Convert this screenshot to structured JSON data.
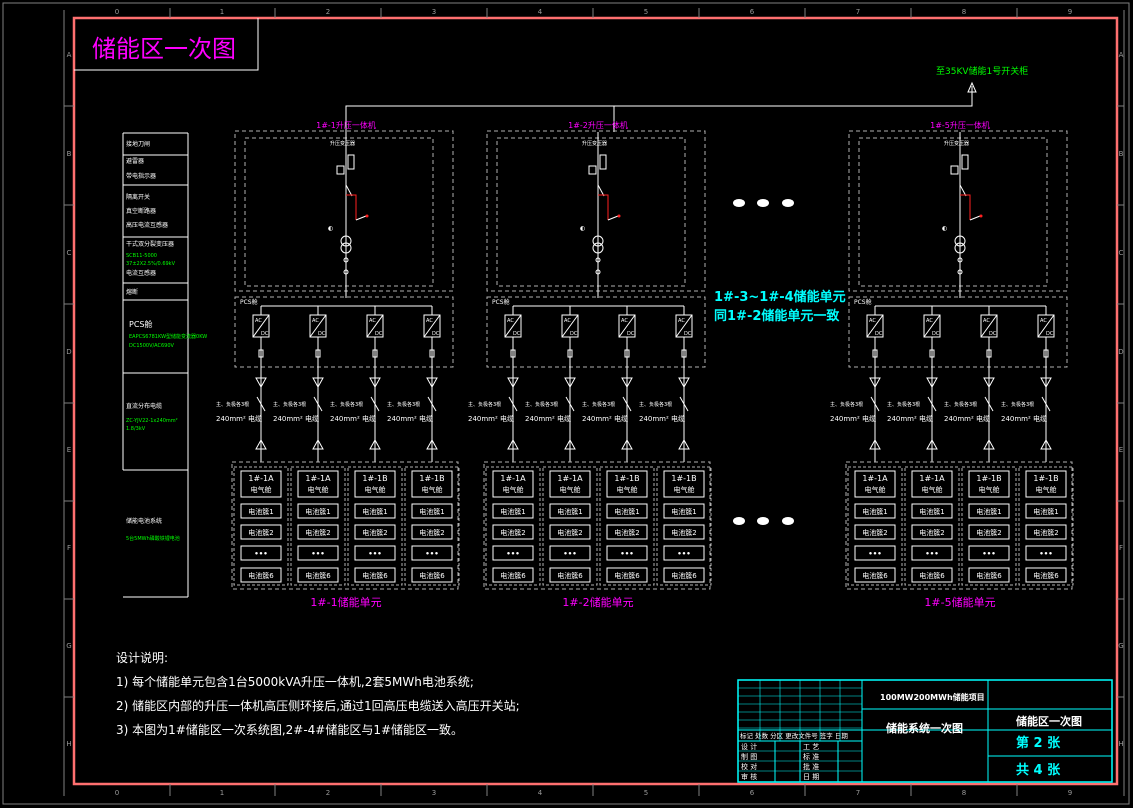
{
  "drawing_title": "储能区一次图",
  "hv_feed_label": "至35KV储能1号开关柜",
  "col_digits": [
    "0",
    "1",
    "2",
    "3",
    "4",
    "5",
    "6",
    "7",
    "8",
    "9"
  ],
  "row_letters": [
    "A",
    "B",
    "C",
    "D",
    "E",
    "F",
    "G",
    "H"
  ],
  "legend": {
    "items": [
      {
        "text": "接地刀闸"
      },
      {
        "text": "避雷器"
      },
      {
        "text": "带电指示器"
      },
      {
        "text": "隔离开关"
      },
      {
        "text": "真空断路器"
      },
      {
        "text": "高压电流互感器"
      },
      {
        "text": "干式双分裂变压器"
      },
      {
        "text": "SCB11-5000"
      },
      {
        "text": "37±2X2.5%/0.69kV"
      },
      {
        "text": "电流互感器"
      },
      {
        "text": "熔断"
      },
      {
        "text": "PCS舱"
      },
      {
        "text": "EAPCS6781KW型储能变流器0KW"
      },
      {
        "text": "DC1500V/AC690V"
      },
      {
        "text": "直流分布电缆"
      },
      {
        "text": "ZC-YJV22-1x240mm²"
      },
      {
        "text": "1.8/3kV"
      },
      {
        "text": "储能电池系统"
      },
      {
        "text": "5台5MWh磷酸铁锂电池"
      }
    ]
  },
  "unit": {
    "transformer_label": "升压变压器",
    "pcs_label": "PCS舱",
    "acdc": [
      "AC",
      "DC"
    ],
    "cable_spec_a": "主、负极各3根",
    "cable_spec_b": "240mm² 电缆",
    "battery_slots": [
      "1#-1A",
      "1#-1A",
      "1#-1B",
      "1#-1B"
    ],
    "battery_sub": "电气舱",
    "cluster_rows": [
      "电池簇1",
      "电池簇2",
      "•••",
      "电池簇6"
    ]
  },
  "units": [
    {
      "title": "1#-1升压一体机",
      "caption": "1#-1储能单元"
    },
    {
      "title": "1#-2升压一体机",
      "caption": "1#-2储能单元"
    },
    {
      "title": "1#-5升压一体机",
      "caption": "1#-5储能单元"
    }
  ],
  "note_same": [
    "1#-3~1#-4储能单元",
    "同1#-2储能单元一致"
  ],
  "design_notes": {
    "heading": "设计说明:",
    "lines": [
      "1) 每个储能单元包含1台5000kVA升压一体机,2套5MWh电池系统;",
      "2) 储能区内部的升压一体机高压侧环接后,通过1回高压电缆送入高压开关站;",
      "3) 本图为1#储能区一次系统图,2#-4#储能区与1#储能区一致。"
    ]
  },
  "title_block": {
    "project": "100MW200MWh储能项目",
    "drawing_name": "储能系统一次图",
    "area_name": "储能区一次图",
    "sheet_no": "第  2  张",
    "sheet_total": "共  4  张",
    "header_row": "标记 处数 分区 更改文件号 签字 日期",
    "roles_left": [
      "设 计",
      "制 图",
      "校 对",
      "审 核"
    ],
    "roles_right": [
      "工 艺",
      "标 准",
      "批 准",
      "日 期"
    ]
  },
  "colors": {
    "frame": "#ff7070",
    "line": "#ffffff",
    "magenta": "#ff00ff",
    "green": "#00ff00",
    "cyan": "#00ffff",
    "red": "#ff2020",
    "dash": "#b0b0b0"
  }
}
